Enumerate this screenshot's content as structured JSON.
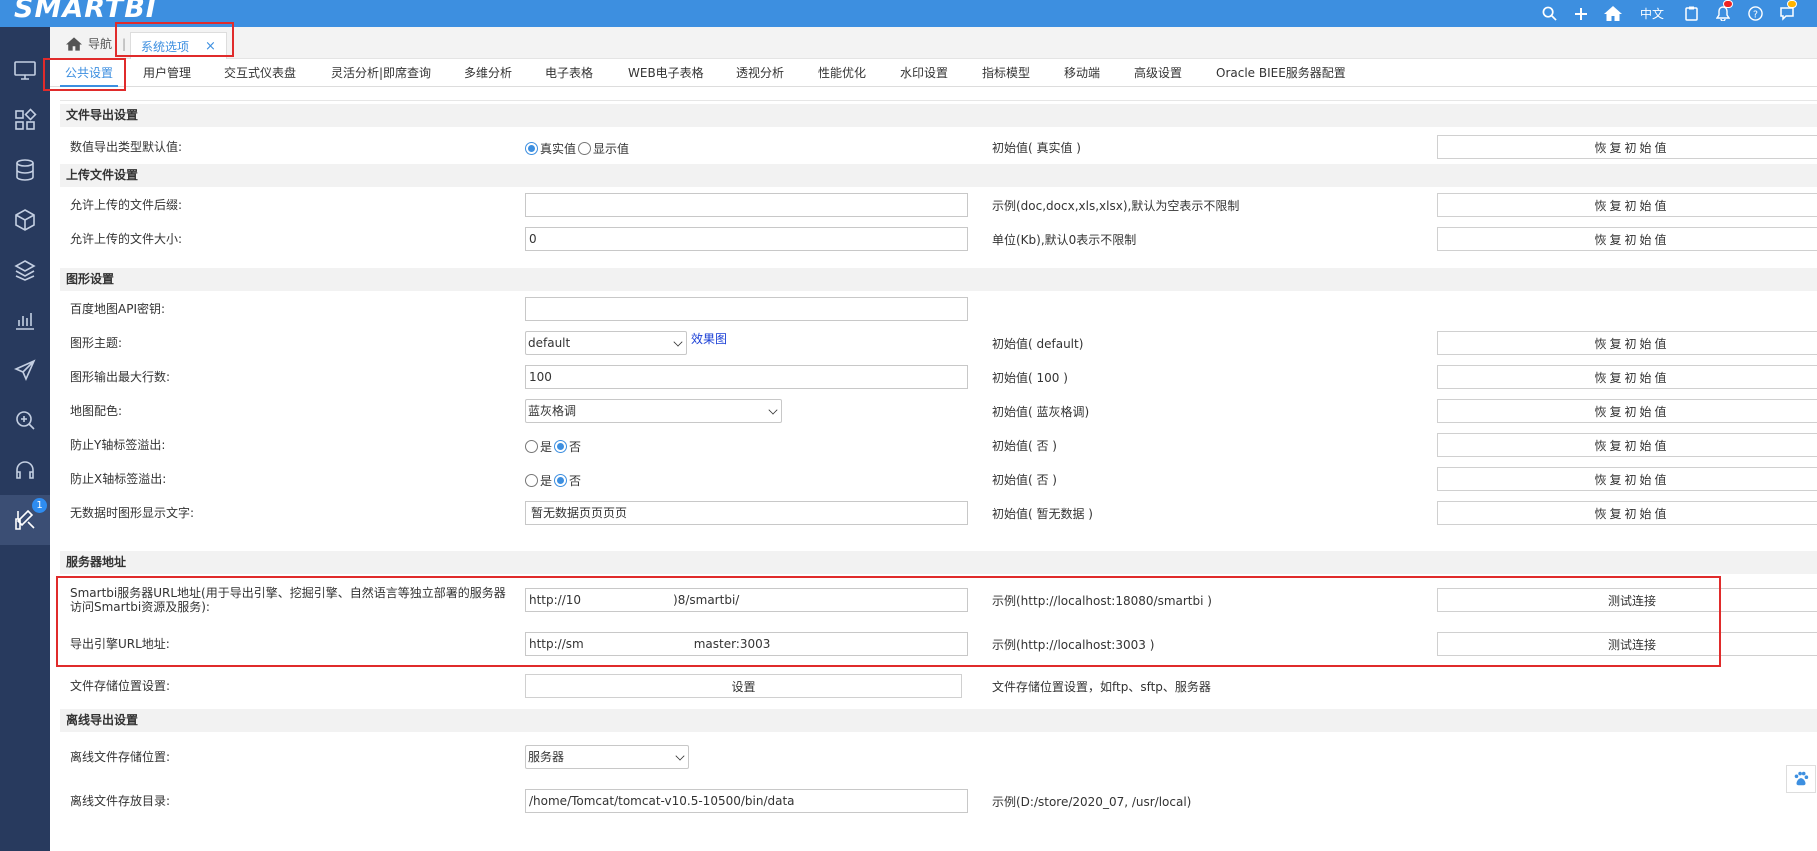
{
  "app": {
    "logo": "SMARTBI"
  },
  "topbar": {
    "lang": "中文",
    "icons": [
      "search-icon",
      "plus-icon",
      "home-icon",
      "language",
      "clipboard-icon",
      "bell-icon",
      "help-icon",
      "chat-icon"
    ]
  },
  "nav": {
    "home_label": "导航",
    "sep": "|",
    "active_tab": "系统选项",
    "close": "×"
  },
  "tabs": [
    "公共设置",
    "用户管理",
    "交互式仪表盘",
    "灵活分析|即席查询",
    "多维分析",
    "电子表格",
    "WEB电子表格",
    "透视分析",
    "性能优化",
    "水印设置",
    "指标模型",
    "移动端",
    "高级设置",
    "Oracle BIEE服务器配置"
  ],
  "sidebar": {
    "badge": "1",
    "icons": [
      "monitor-icon",
      "apps-icon",
      "database-icon",
      "cube-icon",
      "layers-icon",
      "chart-icon",
      "send-icon",
      "analysis-icon",
      "headset-icon",
      "tools-icon"
    ]
  },
  "sections": {
    "export": {
      "title": "文件导出设置",
      "rows": {
        "num_type": {
          "label": "数值导出类型默认值:",
          "opt1": "真实值",
          "opt2": "显示值",
          "hint": "初始值( 真实值 )",
          "btn": "恢复初始值"
        }
      }
    },
    "upload": {
      "title": "上传文件设置",
      "rows": {
        "suffix": {
          "label": "允许上传的文件后缀:",
          "value": "",
          "hint": "示例(doc,docx,xls,xlsx),默认为空表示不限制",
          "btn": "恢复初始值"
        },
        "size": {
          "label": "允许上传的文件大小:",
          "value": "0",
          "hint": "单位(Kb),默认0表示不限制",
          "btn": "恢复初始值"
        }
      }
    },
    "graph": {
      "title": "图形设置",
      "rows": {
        "apikey": {
          "label": "百度地图API密钥:",
          "value": ""
        },
        "theme": {
          "label": "图形主题:",
          "value": "default",
          "link": "效果图",
          "hint": "初始值( default)",
          "btn": "恢复初始值"
        },
        "maxrows": {
          "label": "图形输出最大行数:",
          "value": "100",
          "hint": "初始值( 100 )",
          "btn": "恢复初始值"
        },
        "mapcolor": {
          "label": "地图配色:",
          "value": "蓝灰格调",
          "hint": "初始值( 蓝灰格调)",
          "btn": "恢复初始值"
        },
        "yoverflow": {
          "label": "防止Y轴标签溢出:",
          "opt1": "是",
          "opt2": "否",
          "hint": "初始值( 否 )",
          "btn": "恢复初始值"
        },
        "xoverflow": {
          "label": "防止X轴标签溢出:",
          "opt1": "是",
          "opt2": "否",
          "hint": "初始值( 否 )",
          "btn": "恢复初始值"
        },
        "nodata": {
          "label": "无数据时图形显示文字:",
          "value": "暂无数据页页页页",
          "hint": "初始值( 暂无数据 )",
          "btn": "恢复初始值"
        }
      }
    },
    "server": {
      "title": "服务器地址",
      "rows": {
        "smartbi_url": {
          "label": "Smartbi服务器URL地址(用于导出引擎、挖掘引擎、自然语言等独立部署的服务器访问Smartbi资源及服务):",
          "value_a": "http://10",
          "value_b": ")8/smartbi/",
          "hint": "示例(http://localhost:18080/smartbi )",
          "btn": "测试连接"
        },
        "export_url": {
          "label": "导出引擎URL地址:",
          "value_a": "http://sm",
          "value_b": "master:3003",
          "hint": "示例(http://localhost:3003 )",
          "btn": "测试连接"
        },
        "storage": {
          "label": "文件存储位置设置:",
          "btn": "设置",
          "hint": "文件存储位置设置，如ftp、sftp、服务器"
        }
      }
    },
    "offline": {
      "title": "离线导出设置",
      "rows": {
        "location": {
          "label": "离线文件存储位置:",
          "value": "服务器"
        },
        "dir": {
          "label": "离线文件存放目录:",
          "value": "/home/Tomcat/tomcat-v10.5-10500/bin/data",
          "hint": "示例(D:/store/2020_07, /usr/local)"
        }
      }
    }
  },
  "colors": {
    "topbar": "#3d8fe0",
    "sidebar": "#283a5e",
    "highlight": "#e02b2b"
  }
}
